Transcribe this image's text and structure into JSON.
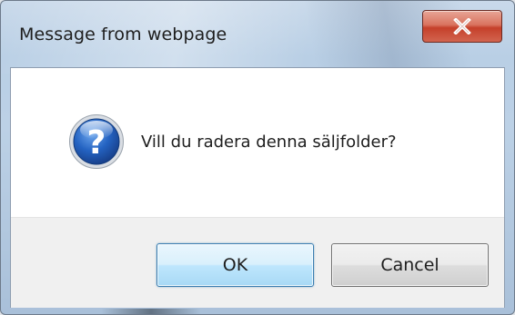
{
  "window": {
    "title": "Message from webpage",
    "close_icon": "close-x-icon"
  },
  "dialog": {
    "icon": "question-icon",
    "message": "Vill du radera denna säljfolder?"
  },
  "buttons": {
    "ok_label": "OK",
    "cancel_label": "Cancel"
  },
  "colors": {
    "close_button": "#c94a35",
    "question_icon": "#1f5fb4",
    "ok_border": "#3c7fb1"
  }
}
